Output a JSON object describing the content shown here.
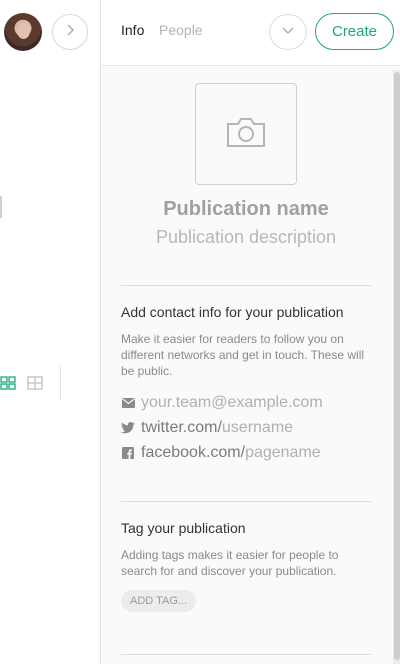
{
  "header": {
    "tabs": [
      {
        "label": "Info"
      },
      {
        "label": "People"
      }
    ],
    "create_label": "Create"
  },
  "publication": {
    "name_placeholder": "Publication name",
    "description_placeholder": "Publication description"
  },
  "contact": {
    "title": "Add contact info for your publication",
    "description": "Make it easier for readers to follow you on different networks and get in touch. These will be public.",
    "email_placeholder": "your.team@example.com",
    "twitter_prefix": "twitter.com/",
    "twitter_placeholder": "username",
    "facebook_prefix": "facebook.com/",
    "facebook_placeholder": "pagename"
  },
  "tags": {
    "title": "Tag your publication",
    "description": "Adding tags makes it easier for people to search for and discover your publication.",
    "add_tag_label": "ADD TAG..."
  },
  "colors": {
    "accent": "#1aa87a",
    "panel_bg": "#fafafa",
    "placeholder": "#b0b0b0"
  },
  "icons": [
    "chevron-right-icon",
    "grid-view-icon",
    "list-view-icon",
    "chevron-down-icon",
    "camera-icon",
    "email-icon",
    "twitter-icon",
    "facebook-icon"
  ]
}
